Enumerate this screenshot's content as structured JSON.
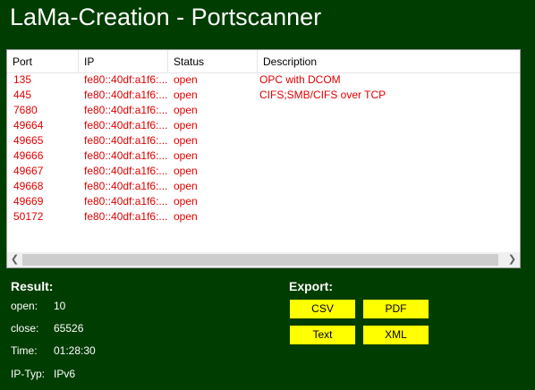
{
  "window": {
    "title": "LaMa-Creation - Portscanner"
  },
  "list": {
    "columns": [
      "Port",
      "IP",
      "Status",
      "Description"
    ],
    "rows": [
      {
        "port": "135",
        "ip": "fe80::40df:a1f6:...",
        "status": "open",
        "description": "OPC with DCOM"
      },
      {
        "port": "445",
        "ip": "fe80::40df:a1f6:...",
        "status": "open",
        "description": "CIFS;SMB/CIFS over TCP"
      },
      {
        "port": "7680",
        "ip": "fe80::40df:a1f6:...",
        "status": "open",
        "description": ""
      },
      {
        "port": "49664",
        "ip": "fe80::40df:a1f6:...",
        "status": "open",
        "description": ""
      },
      {
        "port": "49665",
        "ip": "fe80::40df:a1f6:...",
        "status": "open",
        "description": ""
      },
      {
        "port": "49666",
        "ip": "fe80::40df:a1f6:...",
        "status": "open",
        "description": ""
      },
      {
        "port": "49667",
        "ip": "fe80::40df:a1f6:...",
        "status": "open",
        "description": ""
      },
      {
        "port": "49668",
        "ip": "fe80::40df:a1f6:...",
        "status": "open",
        "description": ""
      },
      {
        "port": "49669",
        "ip": "fe80::40df:a1f6:...",
        "status": "open",
        "description": ""
      },
      {
        "port": "50172",
        "ip": "fe80::40df:a1f6:...",
        "status": "open",
        "description": ""
      }
    ],
    "scroll_left_icon": "chevron-left-icon",
    "scroll_right_icon": "chevron-right-icon"
  },
  "result": {
    "title": "Result:",
    "open_label": "open:",
    "open_value": "10",
    "close_label": "close:",
    "close_value": "65526",
    "time_label": "Time:",
    "time_value": "01:28:30",
    "iptype_label": "IP-Typ:",
    "iptype_value": "IPv6"
  },
  "export": {
    "title": "Export:",
    "csv_label": "CSV",
    "pdf_label": "PDF",
    "text_label": "Text",
    "xml_label": "XML"
  },
  "colors": {
    "background": "#003d00",
    "row_text": "#e00000",
    "button": "#ffff00"
  }
}
